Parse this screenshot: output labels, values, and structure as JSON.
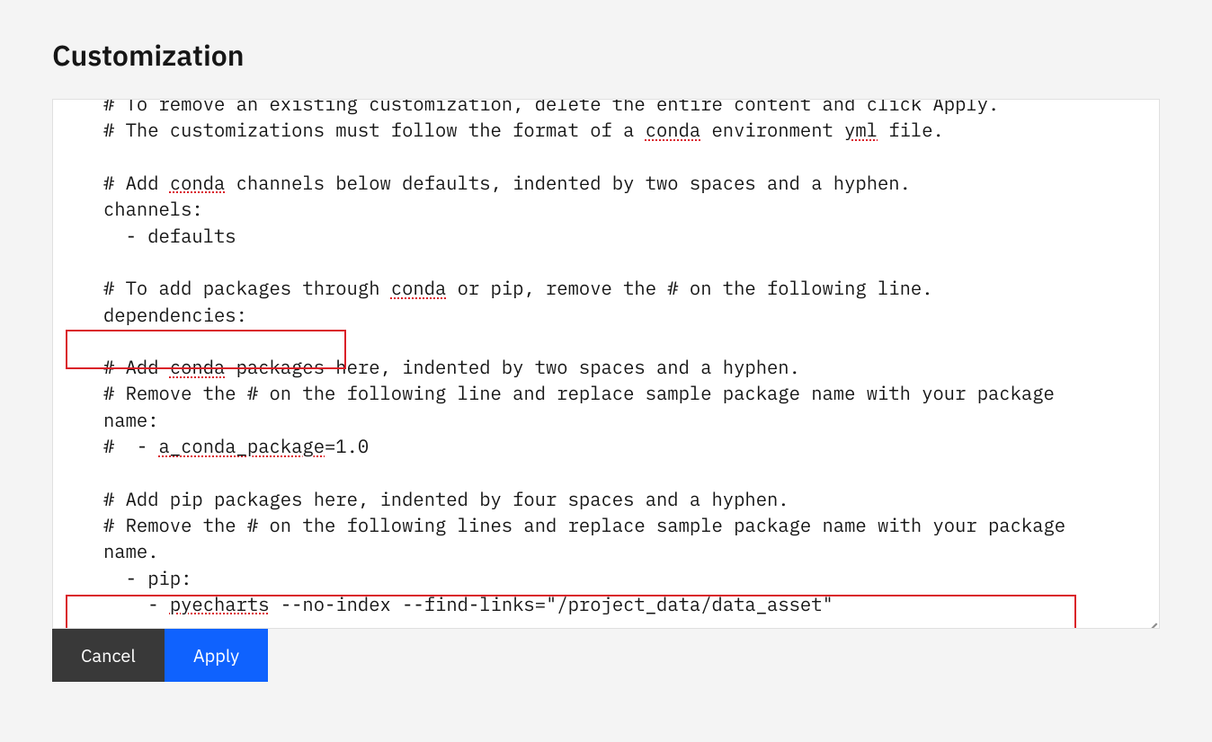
{
  "page": {
    "title": "Customization"
  },
  "editor": {
    "line1_part1": "# To remove an existing customization, delete the entire content and click Apply.",
    "line2_part1": "# The customizations must follow the format of a ",
    "line2_conda": "conda",
    "line2_part2": " environment ",
    "line2_yml": "yml",
    "line2_part3": " file.",
    "line3_part1": "# Add ",
    "line3_conda": "conda",
    "line3_part2": " channels below defaults, indented by two spaces and a hyphen.",
    "line4": "channels:",
    "line5": "  - defaults",
    "line6_part1": "# To add packages through ",
    "line6_conda": "conda",
    "line6_part2": " or pip, remove the # on the following line.",
    "line7": "dependencies:",
    "line8_part1": "# Add ",
    "line8_conda": "conda",
    "line8_part2": " packages here, indented by two spaces and a hyphen.",
    "line9": "# Remove the # on the following line and replace sample package name with your package name:",
    "line10_part1": "#  - ",
    "line10_pkg": "a_conda_package",
    "line10_part2": "=1.0",
    "line11": "# Add pip packages here, indented by four spaces and a hyphen.",
    "line12": "# Remove the # on the following lines and replace sample package name with your package name.",
    "line13": "  - pip:",
    "line14_part1": "    - ",
    "line14_pyecharts": "pyecharts",
    "line14_part2": " --no-index --find-links=\"/project_data/data_asset\""
  },
  "buttons": {
    "cancel": "Cancel",
    "apply": "Apply"
  }
}
